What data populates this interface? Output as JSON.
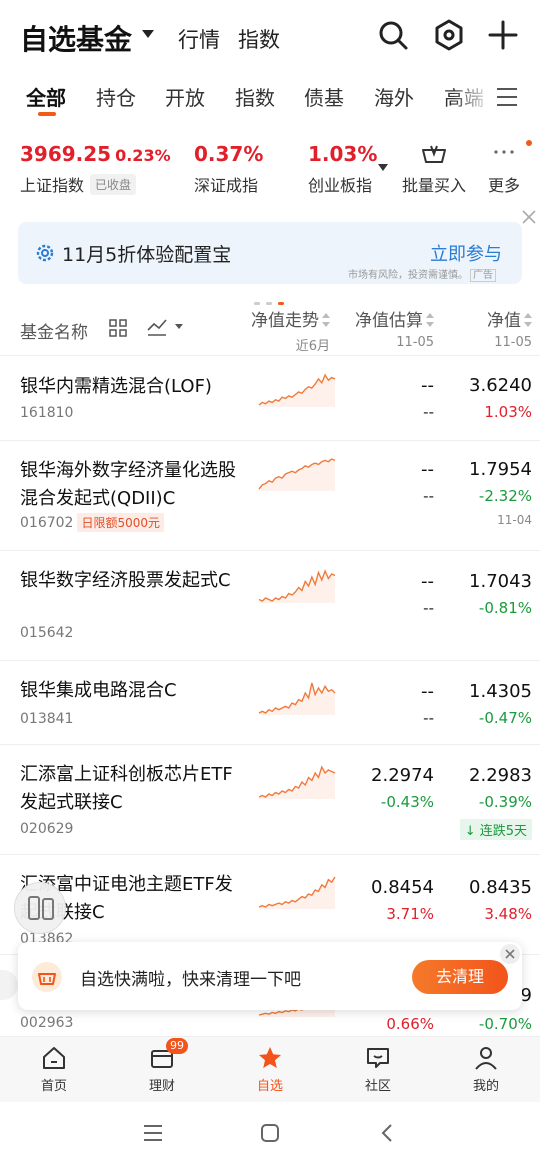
{
  "header": {
    "title": "自选基金",
    "nav": [
      "行情",
      "指数"
    ]
  },
  "tabs": [
    "全部",
    "持仓",
    "开放",
    "指数",
    "债基",
    "海外",
    "高端"
  ],
  "indices": [
    {
      "value": "3969.25",
      "change": "0.23%",
      "name": "上证指数",
      "badge": "已收盘"
    },
    {
      "value": "0.37%",
      "name": "深证成指"
    },
    {
      "value": "1.03%",
      "name": "创业板指"
    }
  ],
  "tools": {
    "batch_buy": "批量买入",
    "more": "更多"
  },
  "banner": {
    "text": "11月5折体验配置宝",
    "cta": "立即参与",
    "note": "市场有风险，投资需谨慎。",
    "ad_label": "广告"
  },
  "table_header": {
    "name": "基金名称",
    "trend": "净值走势",
    "trend_sub": "近6月",
    "estimate": "净值估算",
    "estimate_date": "11-05",
    "nav": "净值",
    "nav_date": "11-05"
  },
  "funds": [
    {
      "name": "银华内需精选混合(LOF)",
      "code": "161810",
      "est": "--",
      "est_chg": "--",
      "nav": "3.6240",
      "nav_chg": "1.03%",
      "trend": [
        10,
        12,
        11,
        13,
        12,
        14,
        13,
        16,
        15,
        17,
        16,
        18,
        20,
        19,
        22,
        24,
        23,
        26,
        30,
        27,
        33,
        29,
        31,
        30
      ]
    },
    {
      "name": "银华海外数字经济量化选股混合发起式(QDII)C",
      "code": "016702",
      "limit": "日限额5000元",
      "est": "--",
      "est_chg": "--",
      "nav": "1.7954",
      "nav_chg": "-2.32%",
      "nav_date": "11-04",
      "trend": [
        10,
        13,
        14,
        16,
        15,
        18,
        19,
        18,
        21,
        22,
        23,
        22,
        24,
        25,
        27,
        26,
        28,
        29,
        28,
        30,
        31,
        30,
        32,
        31
      ]
    },
    {
      "name": "银华数字经济股票发起式C",
      "code": "015642",
      "est": "--",
      "est_chg": "--",
      "nav": "1.7043",
      "nav_chg": "-0.81%",
      "trend": [
        12,
        11,
        13,
        12,
        11,
        13,
        12,
        14,
        13,
        16,
        15,
        17,
        20,
        18,
        24,
        21,
        27,
        22,
        30,
        25,
        31,
        26,
        29,
        28
      ]
    },
    {
      "name": "银华集成电路混合C",
      "code": "013841",
      "est": "--",
      "est_chg": "--",
      "nav": "1.4305",
      "nav_chg": "-0.47%",
      "trend": [
        10,
        11,
        10,
        12,
        11,
        13,
        12,
        13,
        14,
        13,
        16,
        15,
        18,
        17,
        22,
        19,
        28,
        21,
        25,
        22,
        26,
        23,
        24,
        22
      ]
    },
    {
      "name": "汇添富上证科创板芯片ETF发起式联接C",
      "code": "020629",
      "est": "2.2974",
      "est_chg": "-0.43%",
      "nav": "2.2983",
      "nav_chg": "-0.39%",
      "streak": "连跌5天",
      "trend": [
        11,
        12,
        11,
        13,
        12,
        14,
        13,
        15,
        14,
        16,
        15,
        18,
        17,
        21,
        19,
        24,
        22,
        27,
        24,
        31,
        27,
        29,
        28,
        27
      ]
    },
    {
      "name": "汇添富中证电池主题ETF发起式联接C",
      "code": "013862",
      "est": "0.8454",
      "est_chg": "3.71%",
      "nav": "0.8435",
      "nav_chg": "3.48%",
      "trend": [
        10,
        11,
        10,
        12,
        11,
        12,
        13,
        12,
        14,
        13,
        15,
        14,
        16,
        18,
        17,
        20,
        19,
        23,
        22,
        27,
        25,
        31,
        29,
        33
      ]
    },
    {
      "name": "",
      "code": "002963",
      "est": "",
      "est_chg": "0.66%",
      "nav": "9",
      "nav_chg": "-0.70%",
      "trend": [
        10,
        11,
        12,
        11,
        13,
        12,
        14,
        13,
        15,
        14,
        16,
        15,
        17,
        16,
        18,
        17,
        19,
        18,
        20,
        19,
        21,
        20,
        22,
        21
      ]
    }
  ],
  "toast": {
    "text": "自选快满啦，快来清理一下吧",
    "button": "去清理"
  },
  "bottom_nav": [
    {
      "label": "首页",
      "icon": "home-icon"
    },
    {
      "label": "理财",
      "icon": "wallet-icon",
      "badge": "99"
    },
    {
      "label": "自选",
      "icon": "star-icon"
    },
    {
      "label": "社区",
      "icon": "chat-icon"
    },
    {
      "label": "我的",
      "icon": "user-icon"
    }
  ],
  "colors": {
    "accent": "#f2541b",
    "up": "#e0202a",
    "down": "#1a9b3c",
    "link": "#2b7cd3"
  }
}
